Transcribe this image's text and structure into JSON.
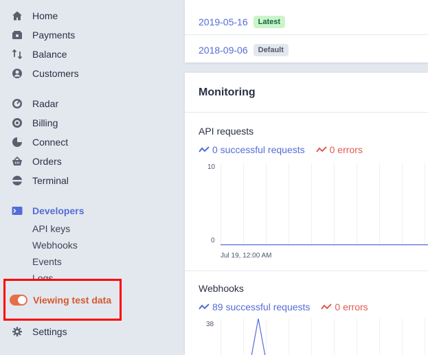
{
  "sidebar": {
    "nav": [
      {
        "label": "Home",
        "icon": "home-icon"
      },
      {
        "label": "Payments",
        "icon": "payments-icon"
      },
      {
        "label": "Balance",
        "icon": "balance-icon"
      },
      {
        "label": "Customers",
        "icon": "customers-icon"
      },
      {
        "label": "Radar",
        "icon": "radar-icon"
      },
      {
        "label": "Billing",
        "icon": "billing-icon"
      },
      {
        "label": "Connect",
        "icon": "connect-icon"
      },
      {
        "label": "Orders",
        "icon": "orders-icon"
      },
      {
        "label": "Terminal",
        "icon": "terminal-icon"
      },
      {
        "label": "Developers",
        "icon": "developers-icon"
      }
    ],
    "developer_sub": [
      "API keys",
      "Webhooks",
      "Events",
      "Logs"
    ],
    "test_data_label": "Viewing test data",
    "settings_label": "Settings"
  },
  "versions": [
    {
      "date": "2019-05-16",
      "badge": "Latest"
    },
    {
      "date": "2018-09-06",
      "badge": "Default"
    }
  ],
  "monitoring": {
    "title": "Monitoring",
    "api": {
      "title": "API requests",
      "success_label": "0 successful requests",
      "error_label": "0 errors",
      "y_max": "10",
      "y_min": "0",
      "x_label": "Jul 19, 12:00 AM"
    },
    "webhooks": {
      "title": "Webhooks",
      "success_label": "89 successful requests",
      "error_label": "0 errors",
      "y_max": "38"
    }
  },
  "colors": {
    "accent": "#556cd6",
    "error": "#e25950",
    "toggle": "#e56f4a",
    "highlight": "#ff0000"
  }
}
